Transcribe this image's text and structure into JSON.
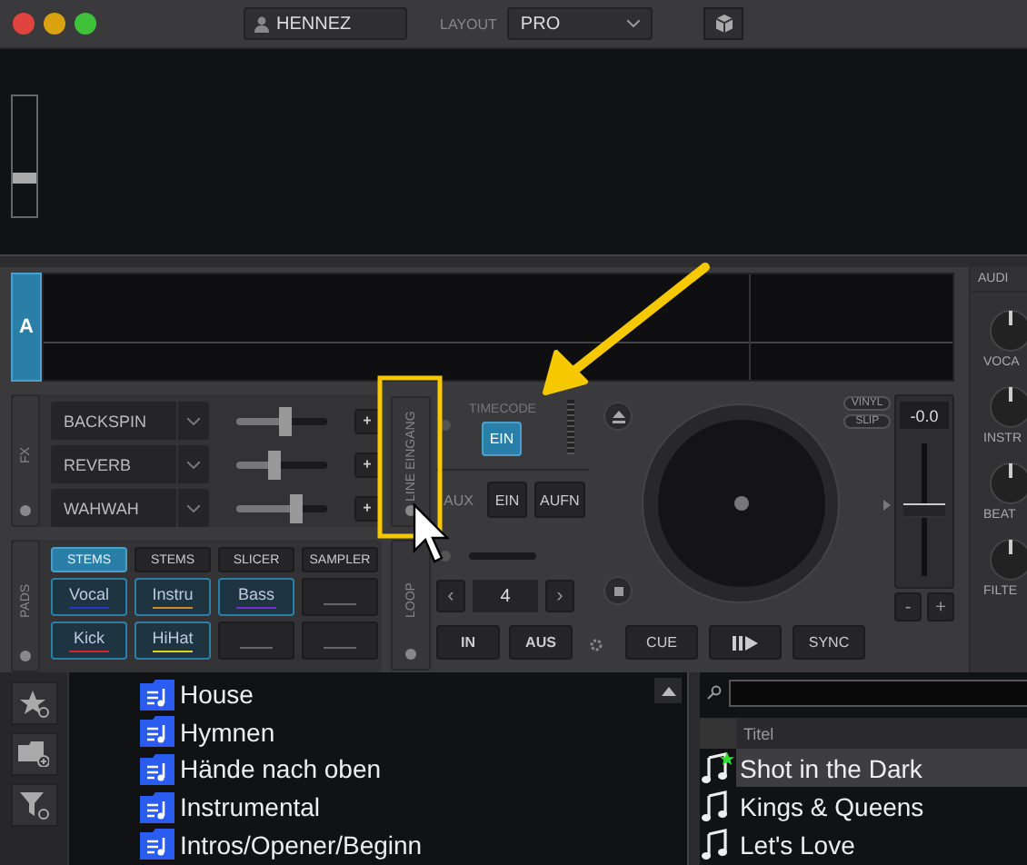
{
  "titlebar": {
    "user": "HENNEZ",
    "layout_label": "LAYOUT",
    "layout": "PRO"
  },
  "top_slider": {
    "level": 0.3
  },
  "deck": {
    "label": "A",
    "fx_label": "FX",
    "effects": [
      {
        "name": "BACKSPIN",
        "level": 0.55,
        "add": "+"
      },
      {
        "name": "REVERB",
        "level": 0.4,
        "add": "+"
      },
      {
        "name": "WAHWAH",
        "level": 0.7,
        "add": "+"
      }
    ],
    "line_input_label": "LINE EINGANG",
    "timecode": {
      "label": "TIMECODE",
      "button": "EIN",
      "on": true
    },
    "aux": {
      "label": "AUX",
      "buttons": [
        "EIN",
        "AUFN"
      ]
    },
    "pads_label": "PADS",
    "pad_modes": [
      {
        "label": "STEMS",
        "selected": true
      },
      {
        "label": "STEMS",
        "selected": false
      },
      {
        "label": "SLICER",
        "selected": false
      },
      {
        "label": "SAMPLER",
        "selected": false
      }
    ],
    "pads": [
      {
        "kind": "stem",
        "label": "Vocal",
        "color": "#2233dd"
      },
      {
        "kind": "stem",
        "label": "Instru",
        "color": "#d08a20"
      },
      {
        "kind": "stem",
        "label": "Bass",
        "color": "#7a2ad8"
      },
      {
        "kind": "empty"
      },
      {
        "kind": "stem",
        "label": "Kick",
        "color": "#d02828"
      },
      {
        "kind": "stem",
        "label": "HiHat",
        "color": "#e0d020"
      },
      {
        "kind": "empty"
      },
      {
        "kind": "empty"
      }
    ],
    "loop": {
      "label": "LOOP",
      "size": "4",
      "prev": "‹",
      "next": "›",
      "buttons": [
        "IN",
        "AUS"
      ]
    },
    "platter": {
      "vinyl": "VINYL",
      "slip": "SLIP"
    },
    "pitch": {
      "reading": "-0.0",
      "level": 0.5,
      "minus": "-",
      "plus": "+"
    },
    "transport": [
      {
        "kind": "text",
        "label": "CUE"
      },
      {
        "kind": "play_pause"
      },
      {
        "kind": "text",
        "label": "SYNC"
      }
    ]
  },
  "mixer": {
    "header": "AUDI",
    "knobs": [
      "VOCA",
      "INSTR",
      "BEAT",
      "FILTE"
    ]
  },
  "browser": {
    "folders": [
      "House",
      "Hymnen",
      "Hände nach oben",
      "Instrumental",
      "Intros/Opener/Beginn"
    ],
    "column": "Titel",
    "tracks": [
      {
        "title": "Shot in the Dark",
        "selected": true,
        "starred": true
      },
      {
        "title": "Kings & Queens",
        "selected": false,
        "starred": false
      },
      {
        "title": "Let's Love",
        "selected": false,
        "starred": false
      }
    ]
  }
}
